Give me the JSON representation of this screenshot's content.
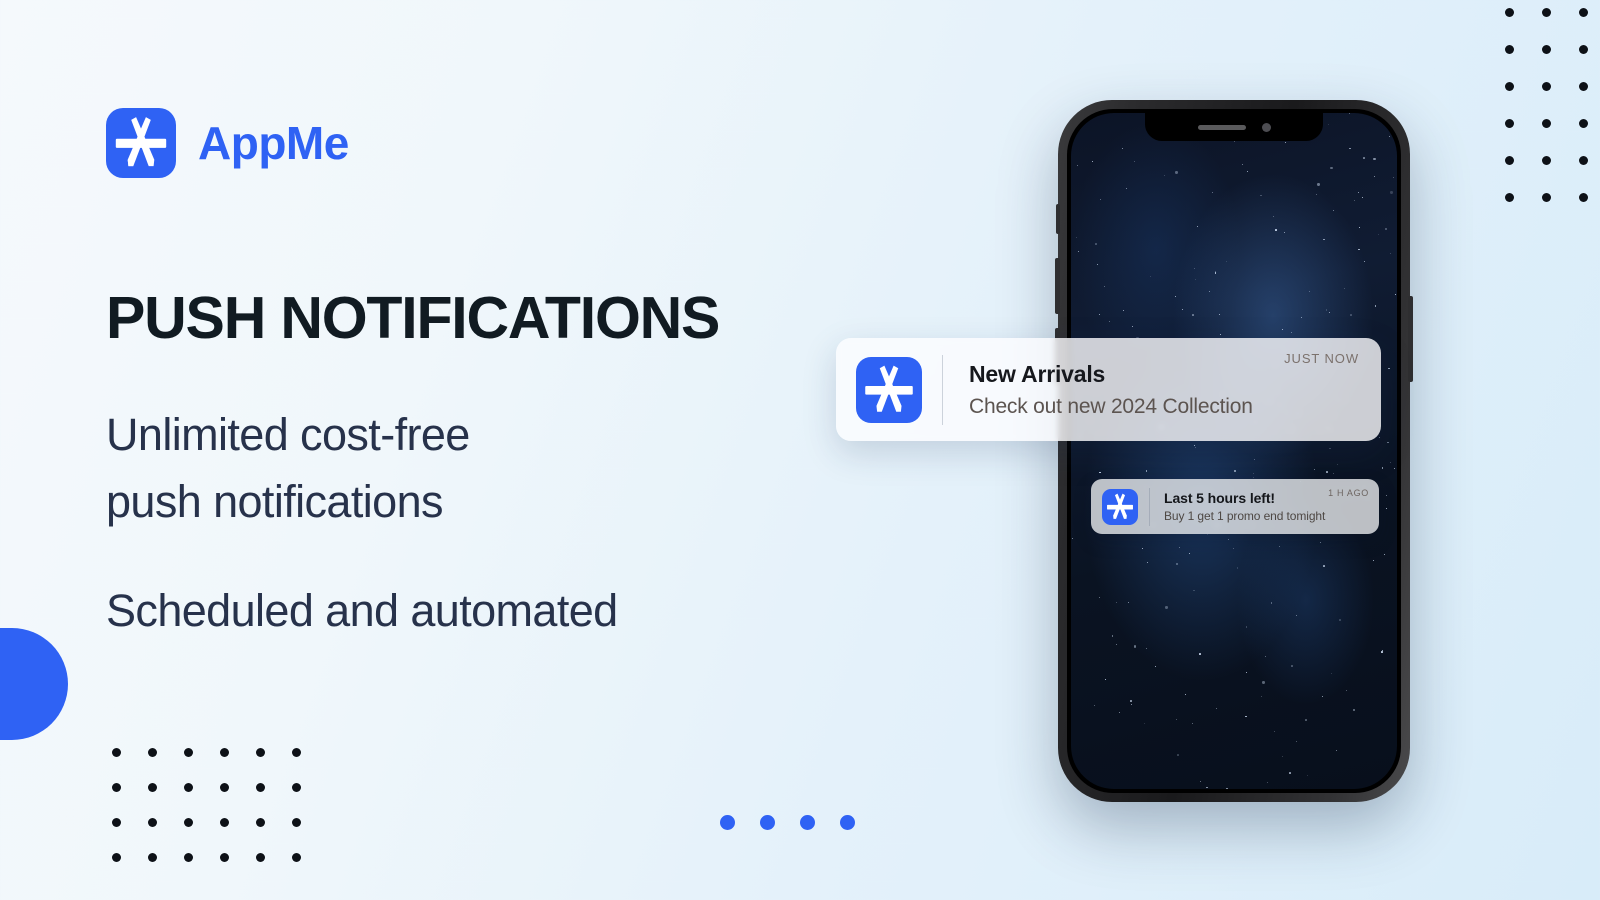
{
  "brand": {
    "name": "AppMe",
    "icon": "app-store-icon",
    "color": "#2f62f4"
  },
  "hero": {
    "headline": "PUSH NOTIFICATIONS",
    "subtitle_line1": "Unlimited cost-free",
    "subtitle_line2": "push notifications",
    "subtitle_2": "Scheduled and automated",
    "text_color": "#111b22",
    "body_color": "#27324b"
  },
  "phone": {
    "notch_elements": [
      "speaker-grille",
      "front-camera"
    ],
    "side_buttons": [
      "silent-switch",
      "volume-up",
      "volume-down",
      "power"
    ],
    "wallpaper": "starfield-night-sky"
  },
  "notifications": [
    {
      "id": "primary",
      "icon": "app-store-icon",
      "title": "New Arrivals",
      "body": "Check out new 2024 Collection",
      "time": "JUST NOW"
    },
    {
      "id": "secondary",
      "icon": "app-store-icon",
      "title": "Last 5 hours left!",
      "body": "Buy 1 get 1 promo end tomight",
      "time": "1 H AGO"
    }
  ],
  "decorations": {
    "dots_top_right": {
      "columns": 3,
      "rows": 6,
      "color": "#0d1117"
    },
    "dots_bottom_left": {
      "columns": 6,
      "rows": 4,
      "color": "#0d1117"
    },
    "dots_center": {
      "count": 4,
      "color": "#2f62f4"
    },
    "blob": {
      "shape": "half-circle",
      "color": "#2f62f4"
    }
  },
  "background": {
    "from": "#f5f9fc",
    "to": "#d8ecf9"
  }
}
